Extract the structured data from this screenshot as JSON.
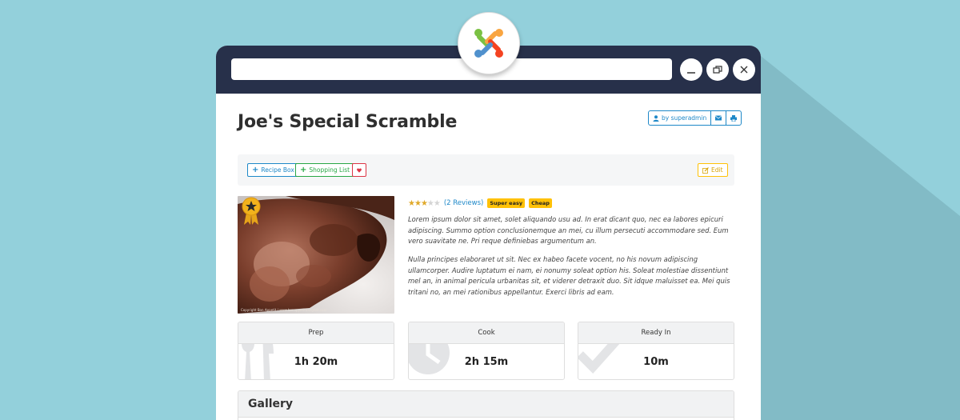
{
  "window": {
    "address_value": "",
    "controls": {
      "minimize_icon": "minimize-icon",
      "restore_icon": "restore-icon",
      "close_icon": "close-icon"
    },
    "logo_icon": "joomla-logo"
  },
  "recipe": {
    "title": "Joe's Special Scramble",
    "author_label": "by superadmin",
    "email_icon": "envelope-icon",
    "print_icon": "print-icon",
    "toolbar": {
      "recipe_box": "Recipe Box",
      "shopping_list": "Shopping List",
      "favorite_icon": "heart-icon",
      "edit": "Edit"
    },
    "rating": {
      "stars_filled": 3,
      "stars_total": 5,
      "reviews": "(2 Reviews)"
    },
    "badges": [
      "Super easy",
      "Cheap"
    ],
    "description": [
      "Lorem ipsum dolor sit amet, solet aliquando usu ad. In erat dicant quo, nec ea labores epicuri adipiscing. Summo option conclusionemque an mei, cu illum persecuti accommodare sed. Eum vero suavitate ne. Pri reque definiebas argumentum an.",
      "Nulla principes elaboraret ut sit. Nec ex habeo facete vocent, no his novum adipiscing ullamcorper. Audire luptatum ei nam, ei nonumy soleat option his. Soleat molestiae dissentiunt mel an, in animal pericula urbanitas sit, et viderer detraxit duo. Sit idque maluisset ea. Mei quis tritani no, an mei rationibus appellantur. Exerci libris ad eam."
    ],
    "photo_caption": "Copyright Bon Appetit / www.bonappetitbangkok.com",
    "times": [
      {
        "label": "Prep",
        "value": "1h 20m",
        "icon": "utensils-icon"
      },
      {
        "label": "Cook",
        "value": "2h 15m",
        "icon": "clock-icon"
      },
      {
        "label": "Ready In",
        "value": "10m",
        "icon": "check-icon"
      }
    ],
    "gallery_title": "Gallery"
  },
  "colors": {
    "background": "#93d0db",
    "titlebar": "#27304a",
    "primary": "#1e88c8",
    "success": "#28a745",
    "danger": "#dc3545",
    "warning": "#ffc107",
    "star": "#e0a92a"
  }
}
